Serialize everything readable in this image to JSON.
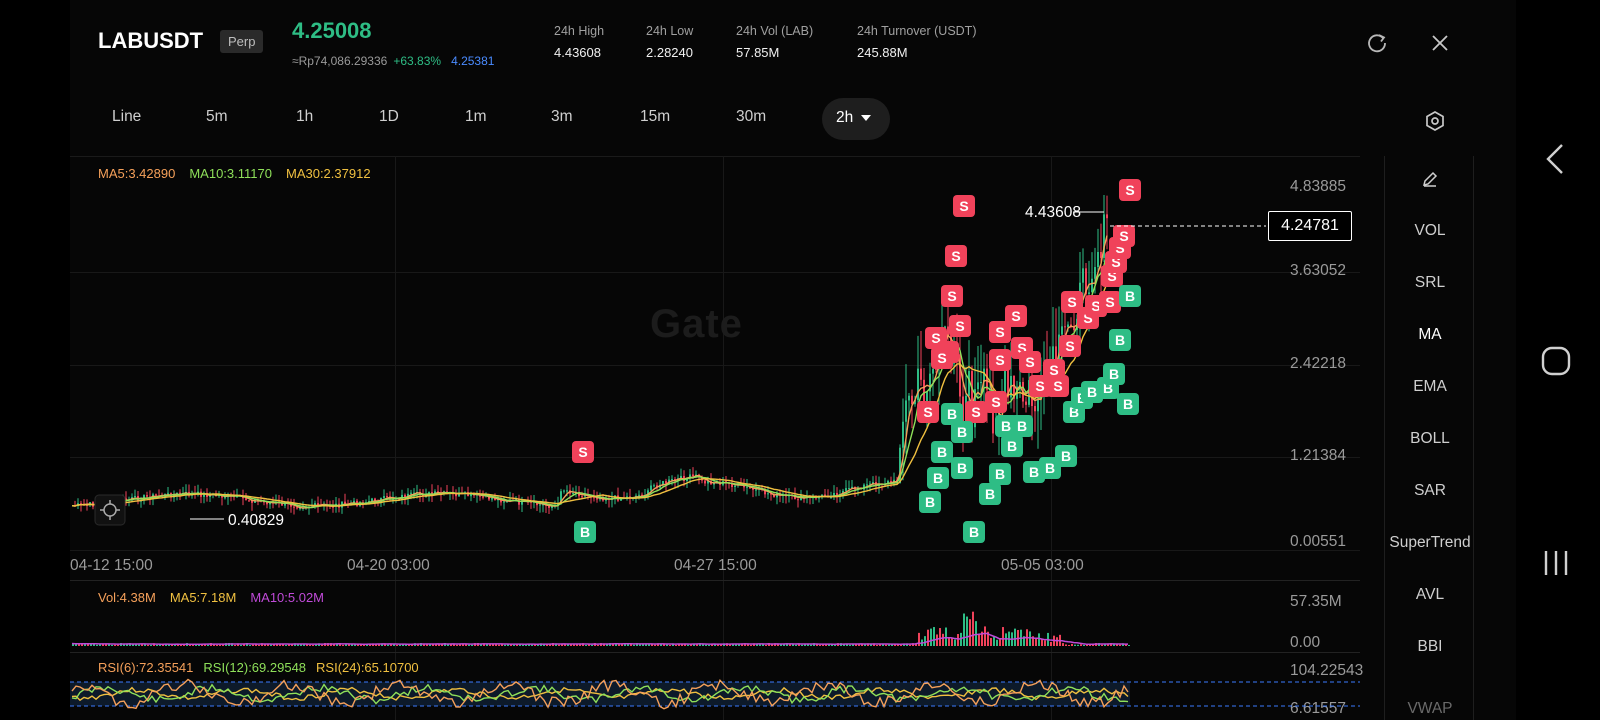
{
  "header": {
    "symbol": "LABUSDT",
    "badge": "Perp",
    "last_price": "4.25008",
    "fiat_price": "≈Rp74,086.29336",
    "change_pct": "+63.83%",
    "mark_price": "4.25381",
    "stats": [
      {
        "key": "24h   High",
        "value": "4.43608"
      },
      {
        "key": "24h   Low",
        "value": "2.28240"
      },
      {
        "key": "24h   Vol (LAB)",
        "value": "57.85M"
      },
      {
        "key": "24h   Turnover (USDT)",
        "value": "245.88M"
      }
    ],
    "refresh_icon": "refresh-icon",
    "close_icon": "close-icon"
  },
  "tabs": [
    "Line",
    "5m",
    "1h",
    "1D",
    "1m",
    "3m",
    "15m",
    "30m"
  ],
  "active_tab": "2h",
  "settings_icon": "hexagon-gear-icon",
  "ma_legend": {
    "ma5": "MA5:3.42890",
    "ma10": "MA10:3.11170",
    "ma30": "MA30:2.37912"
  },
  "y_axis": [
    "4.83885",
    "3.63052",
    "2.42218",
    "1.21384",
    "0.00551"
  ],
  "x_axis": [
    "04-12 15:00",
    "04-20 03:00",
    "04-27 15:00",
    "05-05 03:00"
  ],
  "watermark": "Gate",
  "high_label": "4.43608",
  "low_label": "0.40829",
  "current_price_tag": "4.24781",
  "volume": {
    "vol": "Vol:4.38M",
    "ma5": "MA5:7.18M",
    "ma10": "MA10:5.02M",
    "axis_max": "57.35M",
    "axis_min": "0.00"
  },
  "rsi": {
    "rsi6": "RSI(6):72.35541",
    "rsi12": "RSI(12):69.29548",
    "rsi24": "RSI(24):65.10700",
    "axis_max": "104.22543",
    "axis_min": "6.61557"
  },
  "indicators": [
    "VOL",
    "SRL",
    "MA",
    "EMA",
    "BOLL",
    "SAR",
    "SuperTrend",
    "AVL",
    "BBI",
    "VWAP"
  ],
  "active_indicator": "MA",
  "colors": {
    "up": "#2ebd85",
    "down": "#f0425a",
    "ma5": "#f5a05a",
    "ma10": "#8fe05a",
    "ma30": "#f0c040",
    "vol_ma10": "#c04ad8",
    "mark": "#4a8bff"
  },
  "trade_markers": {
    "buy": "B",
    "sell": "S"
  },
  "android_nav": [
    "back-icon",
    "home-icon",
    "recents-icon"
  ]
}
